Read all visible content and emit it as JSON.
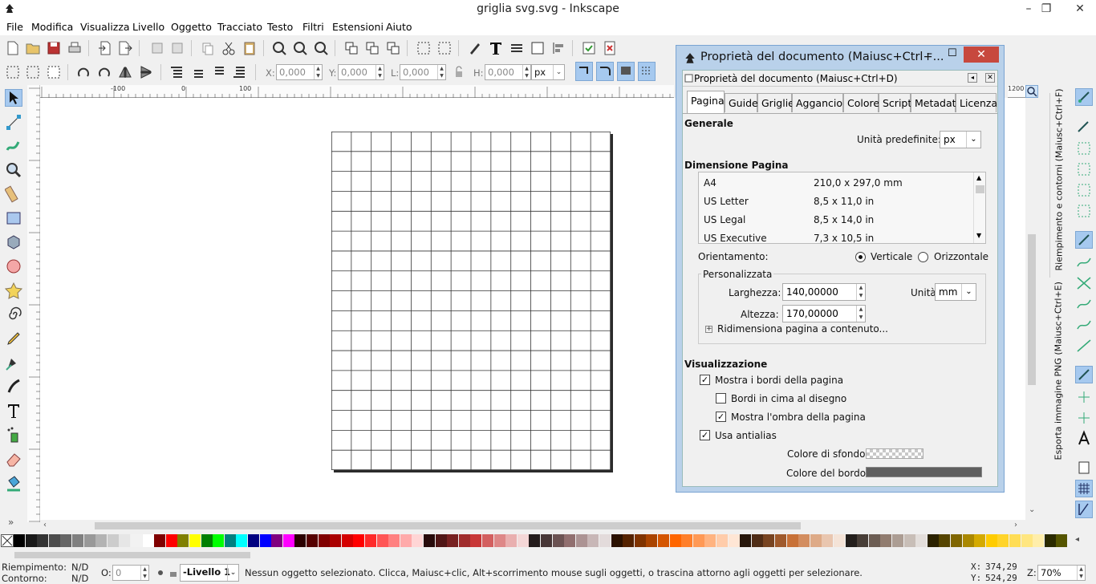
{
  "window": {
    "title": "griglia svg.svg - Inkscape"
  },
  "menu": [
    {
      "label": "File"
    },
    {
      "label": "Modifica"
    },
    {
      "label": "Visualizza"
    },
    {
      "label": "Livello"
    },
    {
      "label": "Oggetto"
    },
    {
      "label": "Tracciato"
    },
    {
      "label": "Testo"
    },
    {
      "label": "Filtri"
    },
    {
      "label": "Estensioni"
    },
    {
      "label": "Aiuto"
    }
  ],
  "toolbar2": {
    "x_label": "X:",
    "x_value": "0,000",
    "y_label": "Y:",
    "y_value": "0,000",
    "w_label": "L:",
    "w_value": "0,000",
    "h_label": "H:",
    "h_value": "0,000",
    "unit": "px"
  },
  "dialog": {
    "window_title": "Proprietà del documento (Maiusc+Ctrl+...",
    "panel_title": "Proprietà del documento (Maiusc+Ctrl+D)",
    "tabs": [
      "Pagina",
      "Guide",
      "Griglie",
      "Aggancio",
      "Colore",
      "Script",
      "Metadati",
      "Licenza"
    ],
    "active_tab": "Pagina",
    "general_heading": "Generale",
    "default_units_label": "Unità predefinite:",
    "default_units_value": "px",
    "page_size_heading": "Dimensione Pagina",
    "page_sizes": [
      {
        "name": "A4",
        "size": "210,0 x 297,0 mm"
      },
      {
        "name": "US Letter",
        "size": "8,5 x 11,0 in"
      },
      {
        "name": "US Legal",
        "size": "8,5 x 14,0 in"
      },
      {
        "name": "US Executive",
        "size": "7,3 x 10,5 in"
      }
    ],
    "orientation_label": "Orientamento:",
    "orientation_vertical": "Verticale",
    "orientation_horizontal": "Orizzontale",
    "orientation_selected": "Verticale",
    "custom_group": "Personalizzata",
    "width_label": "Larghezza:",
    "width_value": "140,00000",
    "height_label": "Altezza:",
    "height_value": "170,00000",
    "units_label": "Unità:",
    "units_value": "mm",
    "resize_expander": "Ridimensiona pagina a contenuto...",
    "display_heading": "Visualizzazione",
    "show_border_label": "Mostra i bordi della pagina",
    "show_border_checked": true,
    "border_on_top_label": "Bordi in cima al disegno",
    "border_on_top_checked": false,
    "show_shadow_label": "Mostra l'ombra della pagina",
    "show_shadow_checked": true,
    "antialias_label": "Usa antialias",
    "antialias_checked": true,
    "bg_color_label": "Colore di sfondo:",
    "border_color_label": "Colore del bordo:",
    "border_color": "#5f5f5f"
  },
  "canvas": {
    "ruler_labels": [
      "-100",
      "0",
      "100"
    ],
    "right_ruler_label": "1200",
    "grid_columns": 14,
    "grid_rows": 17
  },
  "side_tabs": {
    "fill_stroke": "Riempimento e contorni (Maiusc+Ctrl+F)",
    "export_png": "Esporta immagine PNG (Maiusc+Ctrl+E)"
  },
  "palette_colors": [
    "#000000",
    "#1a1a1a",
    "#333333",
    "#4d4d4d",
    "#666666",
    "#808080",
    "#999999",
    "#b3b3b3",
    "#cccccc",
    "#e6e6e6",
    "#f2f2f2",
    "#ffffff",
    "#800000",
    "#ff0000",
    "#808000",
    "#ffff00",
    "#008000",
    "#00ff00",
    "#008080",
    "#00ffff",
    "#000080",
    "#0000ff",
    "#800080",
    "#ff00ff",
    "#2b0000",
    "#550000",
    "#800000",
    "#aa0000",
    "#d40000",
    "#ff0000",
    "#ff2a2a",
    "#ff5555",
    "#ff8080",
    "#ffaaaa",
    "#ffd5d5",
    "#280b0b",
    "#501616",
    "#782121",
    "#a02c2c",
    "#c83737",
    "#d35f5f",
    "#de8787",
    "#e9afaf",
    "#f4d7d7",
    "#241c1c",
    "#483737",
    "#6c5353",
    "#916f6f",
    "#ac9393",
    "#c8b7b7",
    "#e3dbdb",
    "#2b1100",
    "#552200",
    "#803300",
    "#aa4400",
    "#d45500",
    "#ff6600",
    "#ff7f2a",
    "#ff9955",
    "#ffb380",
    "#ffccaa",
    "#ffe6d5",
    "#28170b",
    "#502d16",
    "#784421",
    "#a05a2c",
    "#c87137",
    "#d38d5f",
    "#deaa87",
    "#e9c6af",
    "#f4e3d7",
    "#241f1c",
    "#483e37",
    "#6c5d53",
    "#917c6f",
    "#ac9d93",
    "#c8beb7",
    "#e3dedb",
    "#2b2200",
    "#554400",
    "#806600",
    "#aa8800",
    "#d4aa00",
    "#ffcc00",
    "#ffd42a",
    "#ffdd55",
    "#ffe680",
    "#ffeeaa",
    "#2b2b00",
    "#555500"
  ],
  "status": {
    "fill_label": "Riempimento:",
    "fill_value": "N/D",
    "stroke_label": "Contorno:",
    "stroke_value": "N/D",
    "opacity_label": "O:",
    "opacity_value": "0",
    "layer": "-Livello 1",
    "message": "Nessun oggetto selezionato. Clicca, Maiusc+clic, Alt+scorrimento mouse sugli oggetti, o trascina attorno agli oggetti per selezionare.",
    "x_label": "X:",
    "x_value": "374,29",
    "y_label": "Y:",
    "y_value": "524,29",
    "zoom_label": "Z:",
    "zoom_value": "70%"
  }
}
